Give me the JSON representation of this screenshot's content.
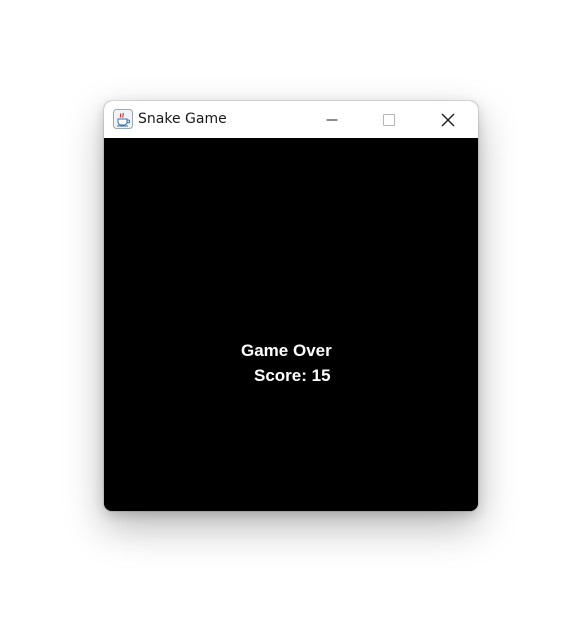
{
  "window": {
    "title": "Snake Game",
    "app_icon": "java-coffee-cup-icon",
    "controls": {
      "minimize_icon": "minimize-icon",
      "maximize_icon": "maximize-icon",
      "close_icon": "close-icon"
    }
  },
  "game": {
    "background_color": "#000000",
    "text_color": "#ffffff",
    "game_over_text": "Game Over",
    "score_text": "Score: 15"
  }
}
